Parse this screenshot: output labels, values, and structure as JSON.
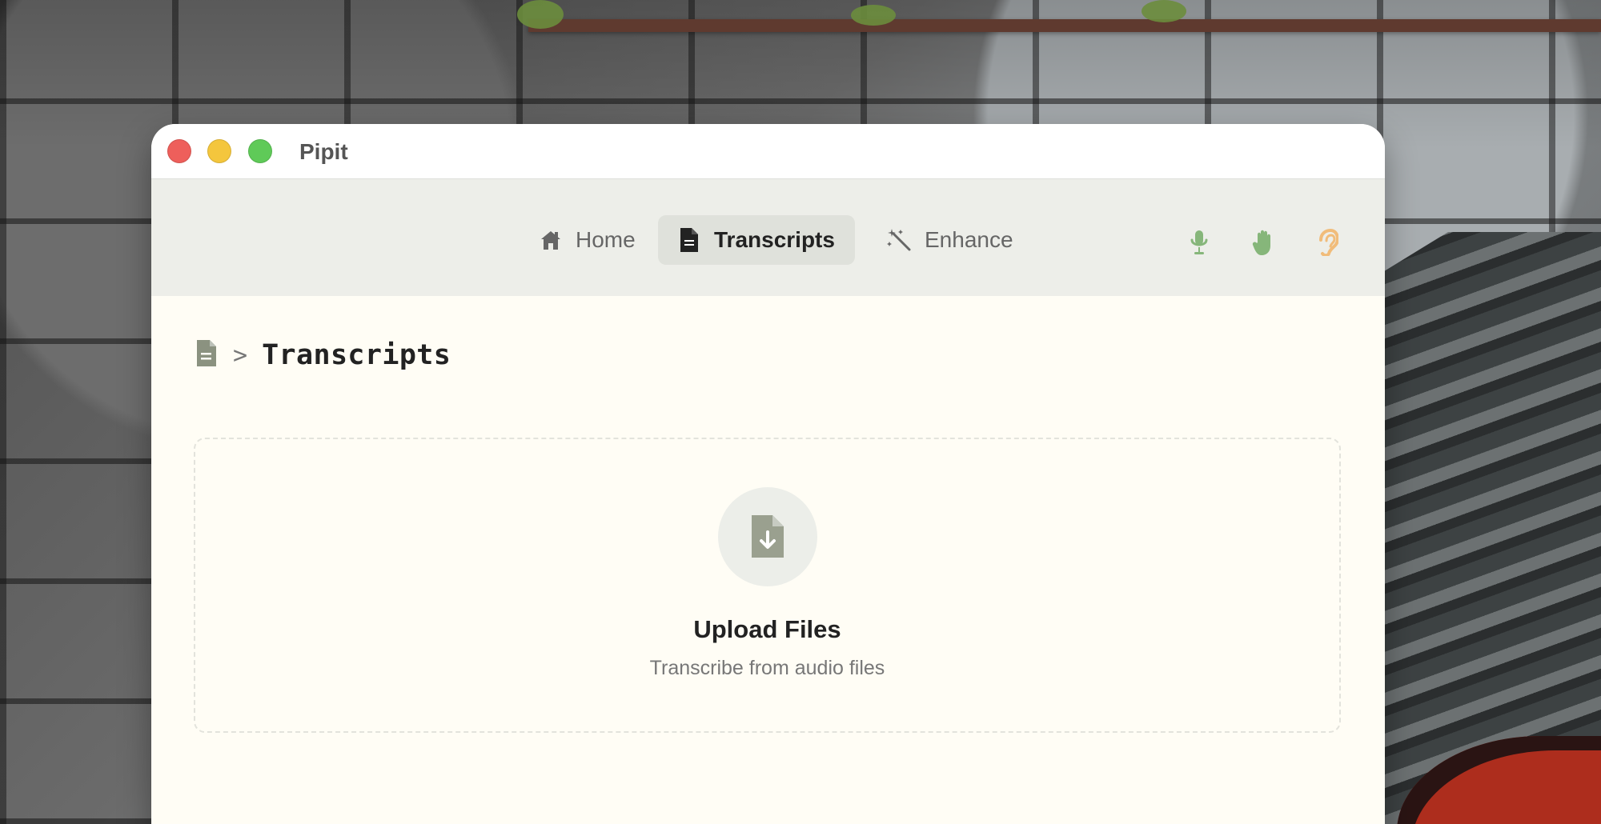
{
  "desktop": {
    "wallpaper": "stone-wall-red-door"
  },
  "window": {
    "title": "Pipit",
    "traffic_lights": [
      "close",
      "minimize",
      "maximize"
    ]
  },
  "nav": {
    "items": [
      {
        "label": "Home",
        "icon": "home-icon",
        "active": false
      },
      {
        "label": "Transcripts",
        "icon": "document-icon",
        "active": true
      },
      {
        "label": "Enhance",
        "icon": "magic-wand-icon",
        "active": false
      }
    ],
    "right_icons": [
      {
        "name": "microphone-icon",
        "color": "#86b67a"
      },
      {
        "name": "hand-icon",
        "color": "#86b67a"
      },
      {
        "name": "ear-icon",
        "color": "#f1bc7a"
      }
    ]
  },
  "main": {
    "breadcrumb": {
      "separator": ">",
      "title": "Transcripts"
    },
    "upload": {
      "title": "Upload Files",
      "subtitle": "Transcribe from audio files",
      "icon": "file-download-icon"
    }
  },
  "colors": {
    "window_background": "#fffdf5",
    "toolbar_background": "#edeee9",
    "active_tab_background": "#dfe1db",
    "muted_icon": "#8b9280"
  }
}
